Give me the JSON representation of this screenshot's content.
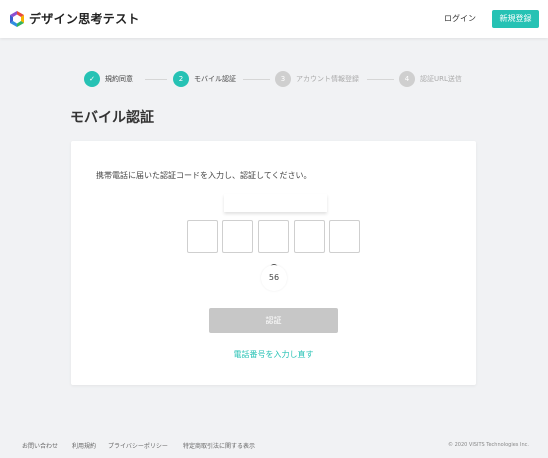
{
  "header": {
    "brand": "デザイン思考テスト",
    "logo_icon": "hexagon-logo-icon",
    "login_label": "ログイン",
    "signup_label": "新規登録",
    "accent_color": "#26c2b4"
  },
  "steps": [
    {
      "number": "✓",
      "label": "規約同意",
      "state": "done"
    },
    {
      "number": "2",
      "label": "モバイル認証",
      "state": "current"
    },
    {
      "number": "3",
      "label": "アカウント情報登録",
      "state": "todo"
    },
    {
      "number": "4",
      "label": "認証URL送信",
      "state": "todo"
    }
  ],
  "page": {
    "title": "モバイル認証"
  },
  "card": {
    "instruction": "携帯電話に届いた認証コードを入力し、認証してください。",
    "code_input_value": "",
    "code_boxes": [
      "",
      "",
      "",
      "",
      ""
    ],
    "timer": "56",
    "verify_label": "認証",
    "re_enter_link": "電話番号を入力し直す"
  },
  "footer": {
    "links": [
      "お問い合わせ",
      "利用規約",
      "プライバシーポリシー",
      "特定商取引法に関する表示"
    ],
    "copyright": "© 2020 VISITS Technologies Inc."
  }
}
